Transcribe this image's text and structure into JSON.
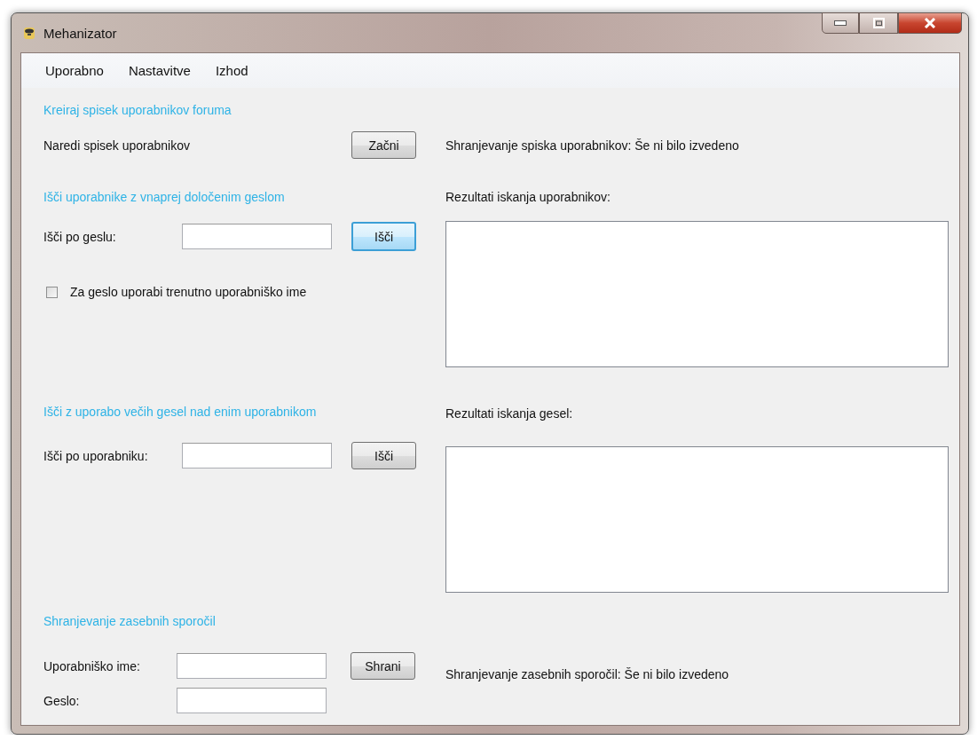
{
  "window": {
    "title": "Mehanizator"
  },
  "menu": [
    {
      "label": "Uporabno"
    },
    {
      "label": "Nastavitve"
    },
    {
      "label": "Izhod"
    }
  ],
  "create_list": {
    "heading": "Kreiraj spisek uporabnikov foruma",
    "label": "Naredi spisek uporabnikov",
    "button": {
      "label": "Začni",
      "focused": false
    },
    "status": "Shranjevanje spiska uporabnikov: Še ni bilo izvedeno"
  },
  "search_by_password": {
    "heading": "Išči uporabnike z vnaprej določenim geslom",
    "label": "Išči po geslu:",
    "button": {
      "label": "Išči",
      "focused": true
    },
    "checkbox": {
      "label": "Za geslo uporabi trenutno uporabniško ime",
      "checked": false
    },
    "results_label": "Rezultati iskanja uporabnikov:"
  },
  "search_by_user": {
    "heading": "Išči z uporabo večih gesel nad enim uporabnikom",
    "label": "Išči po uporabniku:",
    "button": {
      "label": "Išči",
      "focused": false
    },
    "results_label": "Rezultati iskanja gesel:"
  },
  "save_messages": {
    "heading": "Shranjevanje zasebnih sporočil",
    "username_label": "Uporabniško ime:",
    "password_label": "Geslo:",
    "button": {
      "label": "Shrani",
      "focused": false
    },
    "status": "Shranjevanje zasebnih sporočil: Še ni bilo izvedeno"
  }
}
